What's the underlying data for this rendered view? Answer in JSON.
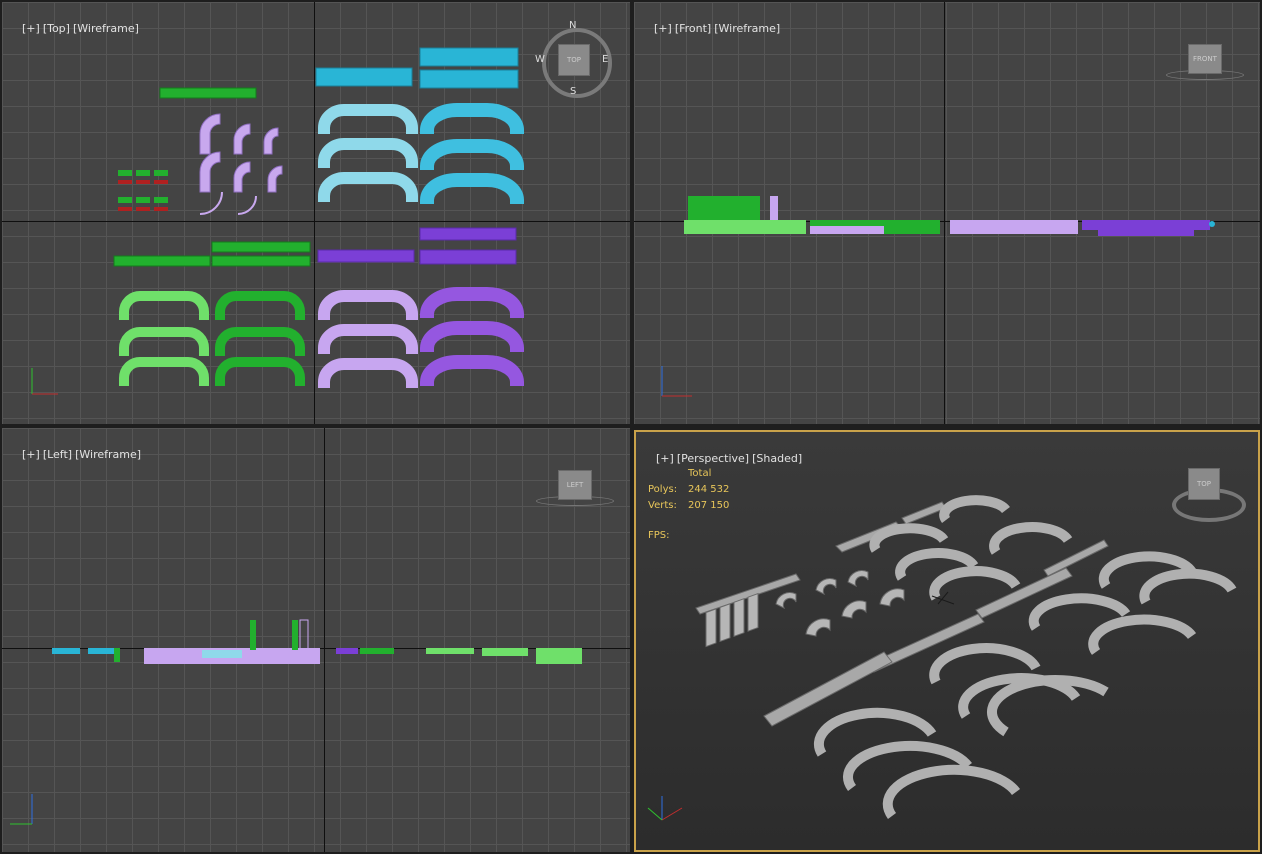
{
  "viewports": {
    "top": {
      "labels": [
        "[+]",
        "[Top]",
        "[Wireframe]"
      ],
      "navigator": "TOP",
      "compass": {
        "n": "N",
        "s": "S",
        "e": "E",
        "w": "W"
      }
    },
    "front": {
      "labels": [
        "[+]",
        "[Front]",
        "[Wireframe]"
      ],
      "navigator": "FRONT"
    },
    "left": {
      "labels": [
        "[+]",
        "[Left]",
        "[Wireframe]"
      ],
      "navigator": "LEFT"
    },
    "perspective": {
      "labels": [
        "[+]",
        "[Perspective]",
        "[Shaded]"
      ],
      "navigator": "TOP",
      "stats": {
        "header": "Total",
        "polys_label": "Polys:",
        "polys": "244 532",
        "verts_label": "Verts:",
        "verts": "207 150",
        "fps_label": "FPS:"
      }
    }
  },
  "colors": {
    "green": "#22b02e",
    "lightgreen": "#6fe06a",
    "cyan": "#29b5d6",
    "lightcyan": "#8fd9ea",
    "purple": "#7b3fd6",
    "lavender": "#b79ae6",
    "grey": "#9a9a9a",
    "accent": "#c9a24a"
  }
}
